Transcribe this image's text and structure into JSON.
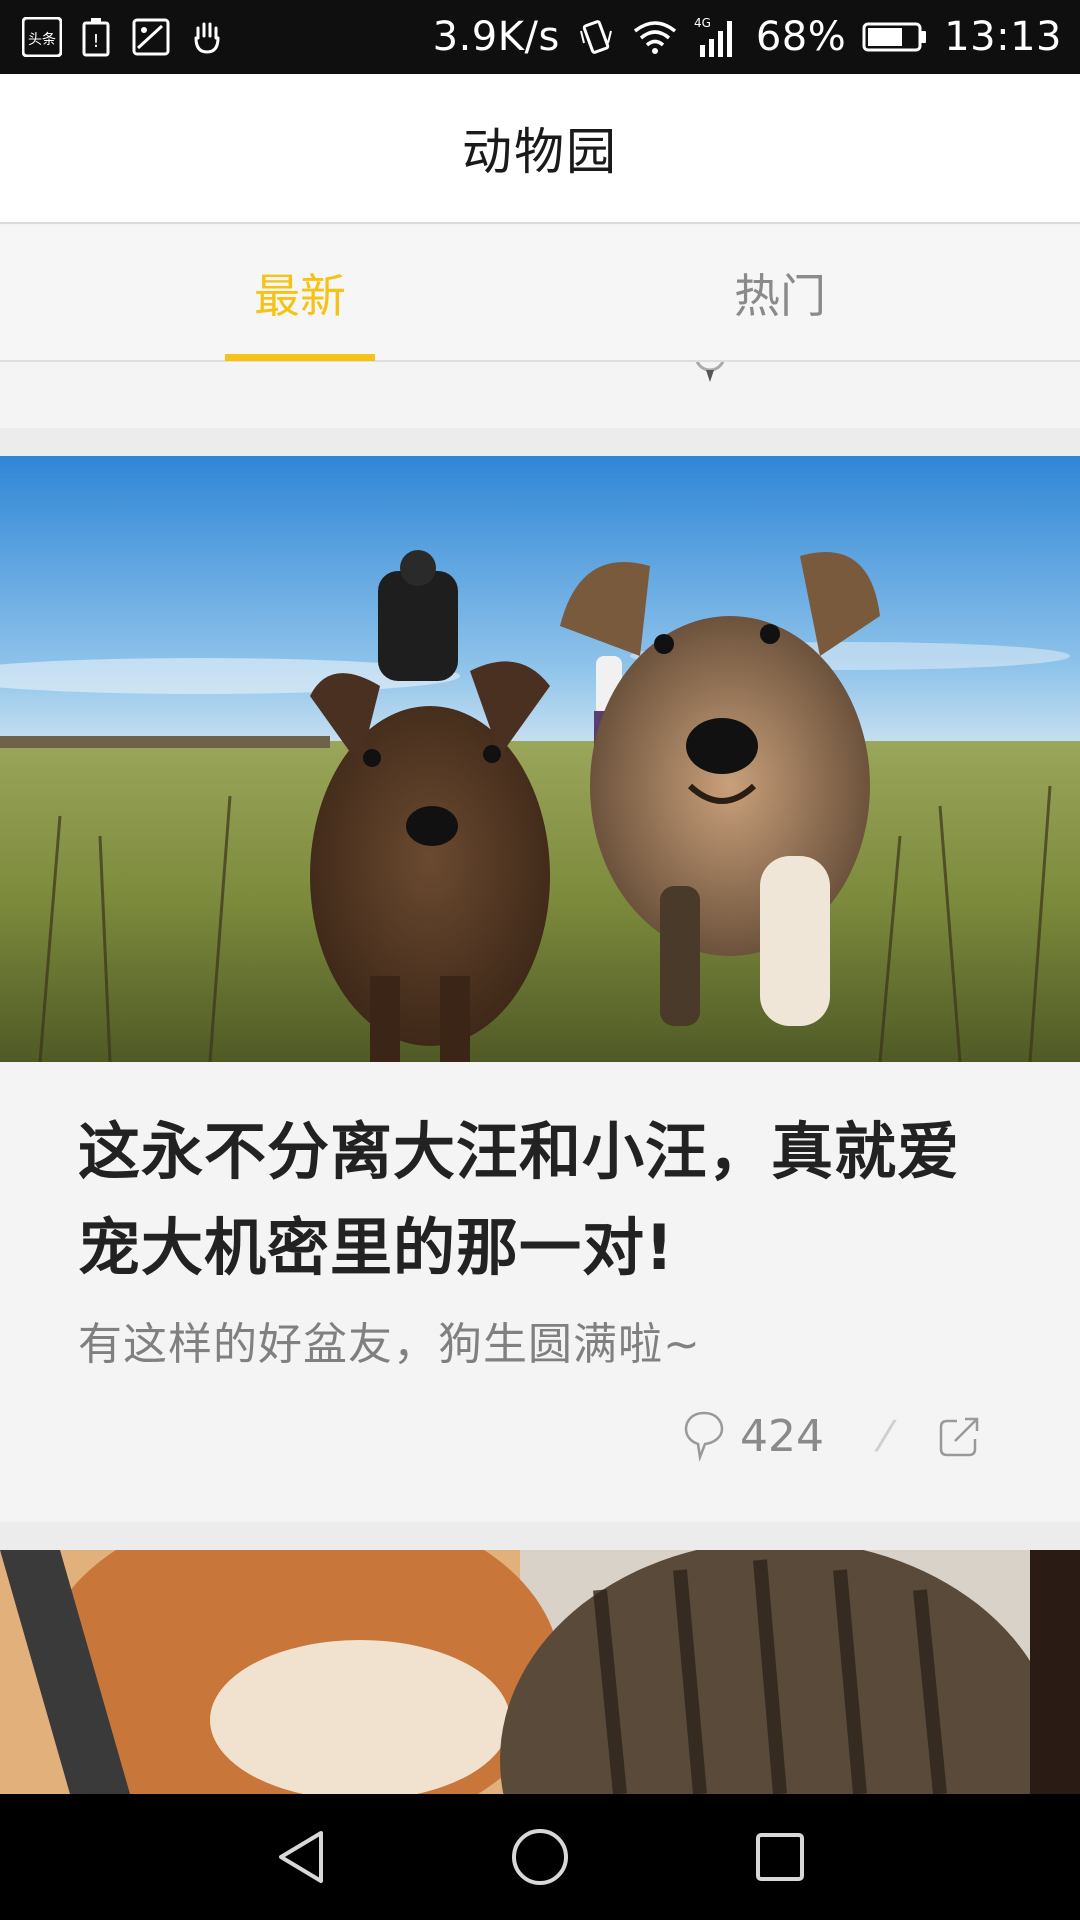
{
  "status_bar": {
    "app_icon_text": "头条",
    "net_speed": "3.9K/s",
    "network_type": "4G",
    "battery": "68%",
    "time": "13:13"
  },
  "header": {
    "title": "动物园"
  },
  "tabs": [
    {
      "label": "最新",
      "active": true
    },
    {
      "label": "热门",
      "active": false
    }
  ],
  "feed": {
    "card": {
      "title": "这永不分离大汪和小汪，真就爱宠大机密里的那一对!",
      "subtitle": "有这样的好盆友，狗生圆满啦~",
      "comment_count": "424"
    }
  },
  "colors": {
    "accent": "#f4c315",
    "status_bar_bg": "#0f0f0f",
    "page_bg": "#f4f4f4"
  },
  "icons": {
    "comment": "comment-bubble-icon",
    "share": "share-icon",
    "back": "back-triangle-icon",
    "home": "home-circle-icon",
    "recent": "recent-square-icon"
  }
}
